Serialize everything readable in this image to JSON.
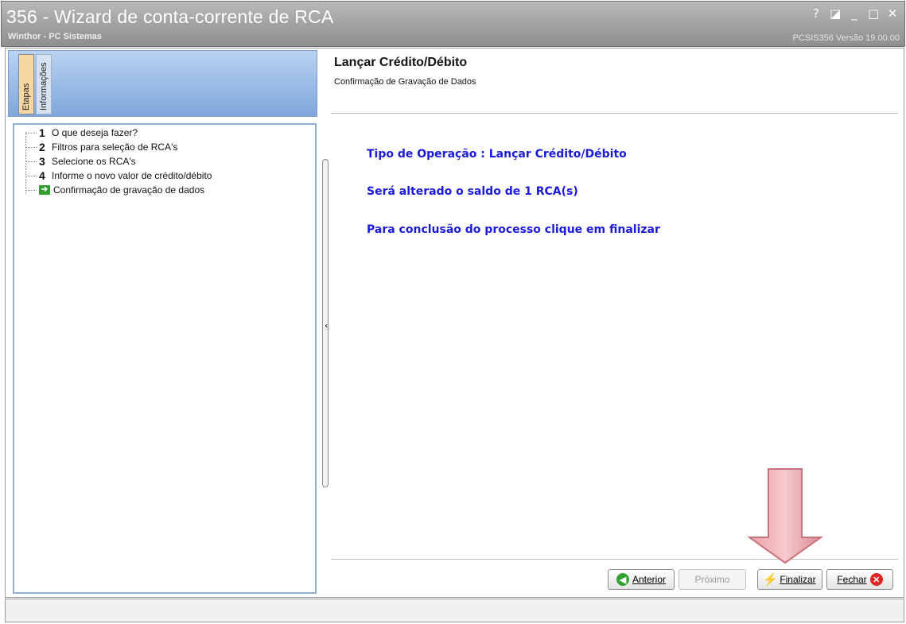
{
  "window": {
    "title": "356 - Wizard de conta-corrente de RCA",
    "subtitle": "Winthor - PC Sistemas",
    "version": "PCSIS356  Versão 19.00.00",
    "controls": {
      "help": "?",
      "restore_alt": "◪",
      "minimize": "_",
      "maximize": "□",
      "close": "✕"
    }
  },
  "left_panel": {
    "tabs": [
      {
        "label": "Etapas"
      },
      {
        "label": "Informações"
      }
    ],
    "steps": [
      {
        "num": "1",
        "label": "O que deseja fazer?"
      },
      {
        "num": "2",
        "label": "Filtros para seleção de RCA's"
      },
      {
        "num": "3",
        "label": "Selecione os RCA's"
      },
      {
        "num": "4",
        "label": "Informe o novo valor de crédito/débito"
      },
      {
        "num": "",
        "label": "Confirmação de gravação de dados",
        "icon": "green-arrow-icon"
      }
    ]
  },
  "main": {
    "title": "Lançar Crédito/Débito",
    "subtitle": "Confirmação de Gravação de Dados",
    "lines": [
      "Tipo de Operação : Lançar Crédito/Débito",
      "Será alterado o saldo de 1 RCA(s)",
      "Para conclusão do processo clique em finalizar"
    ],
    "line_color": "#1a1ad8"
  },
  "buttons": {
    "anterior": {
      "label": "Anterior"
    },
    "proximo": {
      "label": "Próximo"
    },
    "finalizar": {
      "label": "Finalizar"
    },
    "fechar": {
      "label": "Fechar"
    }
  }
}
